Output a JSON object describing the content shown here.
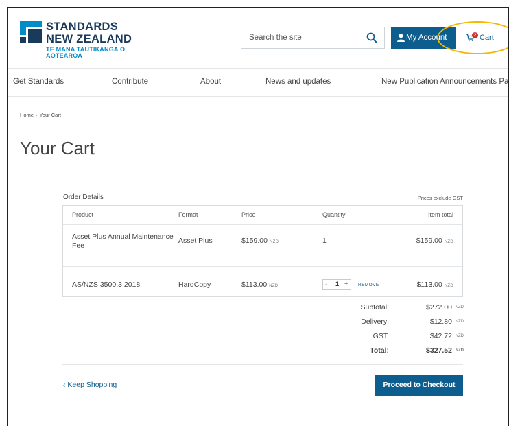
{
  "logo": {
    "line1": "STANDARDS",
    "line2": "NEW ZEALAND",
    "line3": "TE MANA TAUTIKANGA O AOTEAROA"
  },
  "search": {
    "placeholder": "Search the site"
  },
  "account": {
    "label": "My Account"
  },
  "cart": {
    "label": "Cart",
    "count": "2"
  },
  "nav": [
    "Get Standards",
    "Contribute",
    "About",
    "News and updates",
    "New Publication Announcements Page"
  ],
  "breadcrumb": {
    "home": "Home",
    "separator": "›",
    "current": "Your Cart"
  },
  "page_title": "Your Cart",
  "order": {
    "label": "Order Details",
    "note": "Prices exclude GST",
    "headers": [
      "Product",
      "Format",
      "Price",
      "Quantity",
      "Item total"
    ],
    "rows": [
      {
        "product": "Asset Plus Annual Maintenance Fee",
        "format": "Asset Plus",
        "price": "$159.00",
        "quantity": "1",
        "total": "$159.00"
      },
      {
        "product": "AS/NZS 3500.3:2018",
        "format": "HardCopy",
        "price": "$113.00",
        "quantity": "1",
        "total": "$113.00"
      }
    ],
    "currency": "NZD",
    "stepper": {
      "minus": "-",
      "plus": "+"
    },
    "remove_label": "REMOVE"
  },
  "summary": {
    "subtotal_label": "Subtotal:",
    "subtotal": "$272.00",
    "delivery_label": "Delivery:",
    "delivery": "$12.80",
    "gst_label": "GST:",
    "gst": "$42.72",
    "total_label": "Total:",
    "total": "$327.52"
  },
  "actions": {
    "keep_shopping": "Keep Shopping",
    "checkout": "Proceed to Checkout"
  },
  "colors": {
    "brand_blue": "#0d5d8f",
    "logo_navy": "#1a3a5c",
    "logo_accent": "#008cc9",
    "badge_red": "#d0322f",
    "highlight_yellow": "#f5b800"
  }
}
